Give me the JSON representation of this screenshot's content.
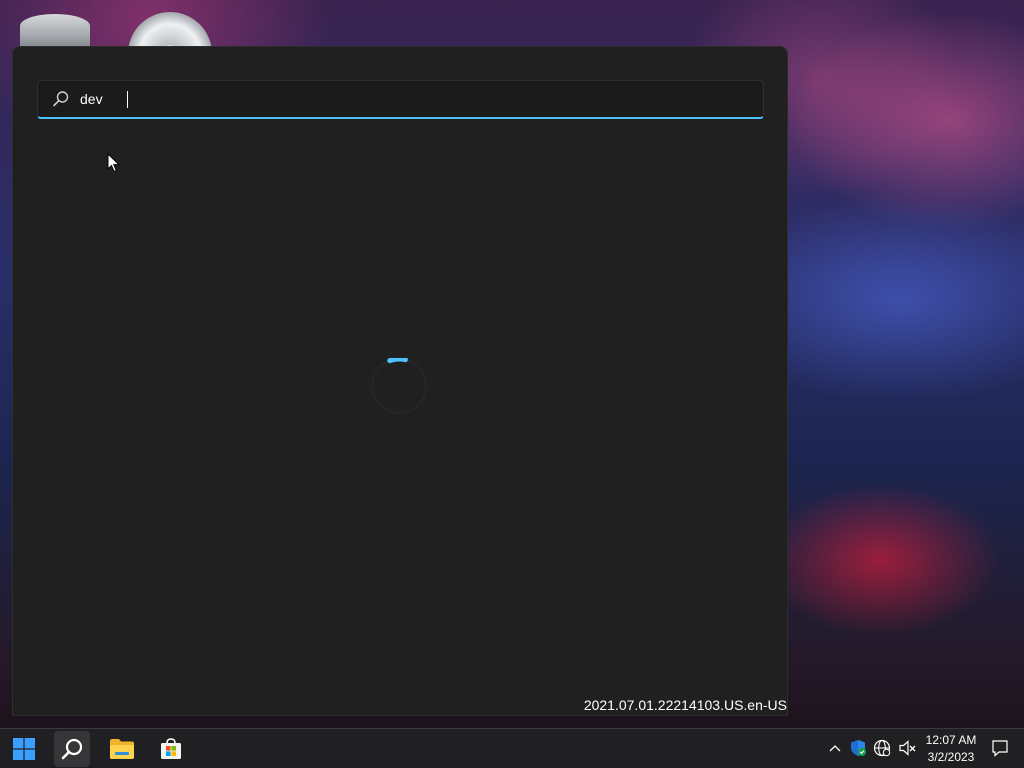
{
  "search": {
    "query": "dev",
    "placeholder": ""
  },
  "panel": {
    "version": "2021.07.01.22214103.US.en-US"
  },
  "taskbar": {
    "items": [
      "start-icon",
      "search-icon",
      "file-explorer-icon",
      "microsoft-store-icon"
    ],
    "tray": {
      "time": "12:07 AM",
      "date": "3/2/2023"
    }
  },
  "colors": {
    "accent": "#4cc2ff",
    "panel_bg": "#202020",
    "windows_blue": "#0078d4"
  }
}
